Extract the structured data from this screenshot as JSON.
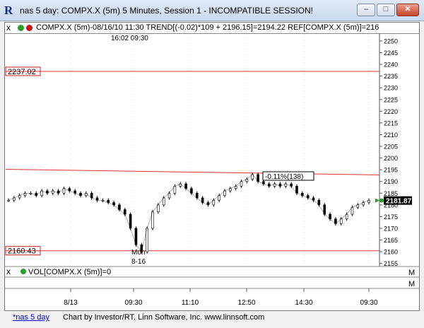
{
  "window": {
    "title": "nas 5 day: COMPX.X (5m) 5 Minutes, Session 1 - INCOMPATIBLE SESSION!",
    "app_icon": "R",
    "buttons": {
      "minimize": "–",
      "maximize": "□",
      "close": "✕"
    }
  },
  "chart_header": {
    "close_glyph": "x",
    "text": "COMPX.X (5m)-08/16/10 11:30  TREND[(-0.02)*109 + 2196.15]=2194.22  REF[COMPX.X (5m)]=216",
    "colors": [
      "#2a9d2a",
      "#c81010"
    ]
  },
  "time_label": "16:02  09:30",
  "annotations": {
    "pct_change": "-0.11%(138)",
    "session_marker_line1": "Mon",
    "session_marker_line2": "8-16"
  },
  "side_labels": {
    "price_tag": "2181.87",
    "upper_ref": "2237.02",
    "lower_ref": "2160.43",
    "m_glyph": "M"
  },
  "volume_header": {
    "close_glyph": "x",
    "text": "VOL[COMPX.X (5m)]=0"
  },
  "tabs": {
    "active": "*nas 5 day"
  },
  "footer_credit": "Chart by Investor/RT, Linn Software, Inc. www.linnsoft.com",
  "chart_data": {
    "type": "line",
    "title": "",
    "xlabel": "",
    "ylabel": "",
    "ylim": [
      2154,
      2253
    ],
    "y_ticks": [
      2155,
      2160,
      2165,
      2170,
      2175,
      2180,
      2185,
      2190,
      2195,
      2200,
      2205,
      2210,
      2215,
      2220,
      2225,
      2230,
      2235,
      2240,
      2245,
      2250
    ],
    "x_ticks": [
      "8/13",
      "09:30",
      "11:10",
      "12:50",
      "14:30",
      "09:30"
    ],
    "reference_lines": [
      {
        "value": 2237.02
      },
      {
        "value": 2160.43
      }
    ],
    "trend_line": {
      "start": 2195.2,
      "end": 2192.8
    },
    "last_price": 2181.87,
    "series": [
      {
        "values": [
          2182,
          2183,
          2184,
          2185,
          2185,
          2184,
          2186,
          2185,
          2186,
          2185,
          2187,
          2186,
          2185,
          2184,
          2185,
          2183,
          2182,
          2182,
          2181,
          2180,
          2178,
          2176,
          2170,
          2163,
          2160,
          2170,
          2177,
          2180,
          2183,
          2185,
          2188,
          2189,
          2187,
          2185,
          2183,
          2181,
          2180,
          2182,
          2184,
          2186,
          2187,
          2188,
          2190,
          2191,
          2193,
          2190,
          2189,
          2188,
          2189,
          2188,
          2189,
          2188,
          2185,
          2184,
          2183,
          2182,
          2180,
          2176,
          2174,
          2172,
          2174,
          2176,
          2179,
          2180,
          2181,
          2182
        ]
      }
    ]
  }
}
